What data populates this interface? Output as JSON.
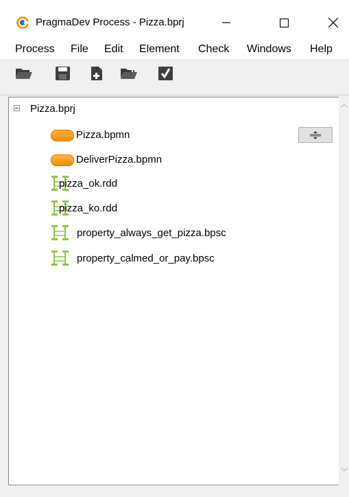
{
  "window": {
    "title": "PragmaDev Process - Pizza.bprj",
    "icons": {
      "app": "pragmadev-logo-icon",
      "minimize": "minimize-icon",
      "maximize": "maximize-icon",
      "close": "close-icon"
    }
  },
  "menubar": {
    "items": [
      "Process",
      "File",
      "Edit",
      "Element",
      "Check",
      "Windows",
      "Help"
    ]
  },
  "toolbar": {
    "buttons": [
      {
        "icon": "open-folder-icon"
      },
      {
        "icon": "save-icon"
      },
      {
        "icon": "new-file-icon"
      },
      {
        "icon": "add-folder-icon"
      },
      {
        "icon": "check-icon"
      }
    ]
  },
  "tree": {
    "root": {
      "label": "Pizza.bprj",
      "expanded": true
    },
    "items": [
      {
        "label": "Pizza.bpmn",
        "type": "bpmn",
        "icon": "bpmn-process-icon"
      },
      {
        "label": "DeliverPizza.bpmn",
        "type": "bpmn",
        "icon": "bpmn-process-icon"
      },
      {
        "label": "pizza_ok.rdd",
        "type": "rdd",
        "icon": "sequence-diagram-icon"
      },
      {
        "label": "pizza_ko.rdd",
        "type": "rdd",
        "icon": "sequence-diagram-icon"
      },
      {
        "label": "property_always_get_pizza.bpsc",
        "type": "bpsc",
        "icon": "sequence-diagram-icon"
      },
      {
        "label": "property_calmed_or_pay.bpsc",
        "type": "bpsc",
        "icon": "sequence-diagram-icon"
      }
    ]
  },
  "colors": {
    "bpmn_orange": "#f28c00",
    "rdd_green": "#8dc63f",
    "panel_border": "#828790"
  }
}
